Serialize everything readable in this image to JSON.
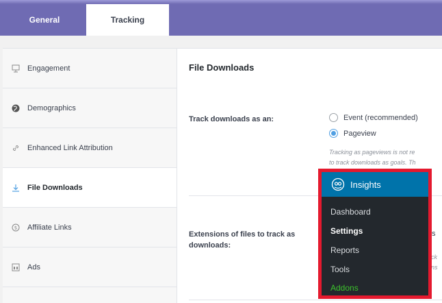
{
  "tabs": [
    {
      "label": "General"
    },
    {
      "label": "Tracking"
    }
  ],
  "sidebar": {
    "items": [
      {
        "label": "Engagement",
        "icon": "presentation-icon"
      },
      {
        "label": "Demographics",
        "icon": "globe-icon"
      },
      {
        "label": "Enhanced Link Attribution",
        "icon": "link-icon"
      },
      {
        "label": "File Downloads",
        "icon": "download-icon"
      },
      {
        "label": "Affiliate Links",
        "icon": "dollar-circle-icon"
      },
      {
        "label": "Ads",
        "icon": "ads-icon"
      }
    ],
    "active_index": 3
  },
  "main": {
    "title": "File Downloads",
    "track_as": {
      "label": "Track downloads as an:",
      "options": [
        {
          "label": "Event (recommended)",
          "selected": false
        },
        {
          "label": "Pageview",
          "selected": true
        }
      ],
      "help_line1": "Tracking as pageviews is not re",
      "help_line2": "to track downloads as goals. Th"
    },
    "extensions": {
      "label_line1": "Extensions of files to track as",
      "label_line2": "downloads:",
      "partial_input_text": "s",
      "partial_help_line1": "ck",
      "partial_help_line2": "ns"
    }
  },
  "wp_menu": {
    "header": "Insights",
    "items": [
      {
        "label": "Dashboard"
      },
      {
        "label": "Settings",
        "current": true
      },
      {
        "label": "Reports"
      },
      {
        "label": "Tools"
      },
      {
        "label": "Addons"
      }
    ],
    "colors": {
      "header_bg": "#0073aa",
      "menu_bg": "#23282d",
      "highlight_border": "#e4192e",
      "addons": "#3cc12c"
    }
  },
  "colors": {
    "topbar": "#6f6bb3",
    "accent": "#509fe2"
  }
}
